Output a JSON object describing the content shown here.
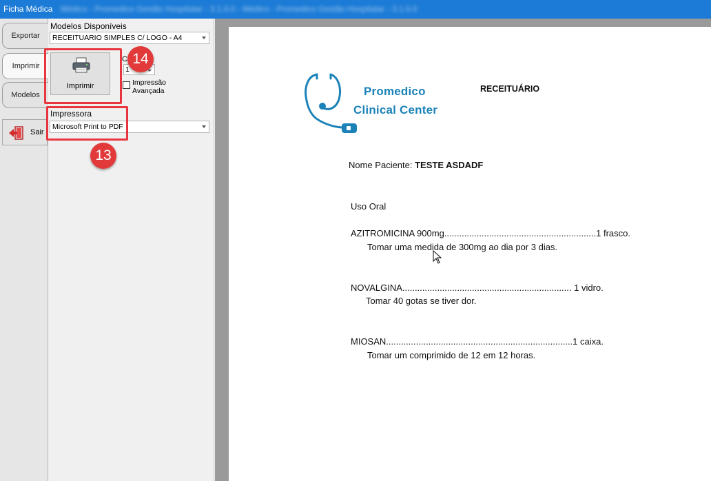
{
  "window": {
    "title": "Ficha Médica",
    "blurred_title": "Médico - Promedico Gestão Hospitalar - 3.1.0.0 - Médico - Promedico Gestão Hospitalar - 3.1.0.0"
  },
  "tabs": {
    "exportar": "Exportar",
    "imprimir": "Imprimir",
    "modelos": "Modelos",
    "sair": "Sair"
  },
  "options": {
    "modelos_label": "Modelos Disponíveis",
    "modelos_value": "RECEITUARIO SIMPLES C/ LOGO - A4",
    "print_button": "Imprimir",
    "copies_label": "C",
    "copies_value": "1",
    "advanced_line1": "Impressão",
    "advanced_line2": "Avançada",
    "printer_label": "Impressora",
    "printer_value": "Microsoft Print to PDF"
  },
  "annotations": {
    "badge_print": "14",
    "badge_printer": "13",
    "color": "#e8353e"
  },
  "document": {
    "logo_line1": "Promedico",
    "logo_line2": "Clinical Center",
    "heading": "RECEITUÁRIO",
    "patient_label": "Nome Paciente: ",
    "patient_name": "TESTE ASDADF",
    "route": "Uso Oral",
    "items": [
      {
        "line": "AZITROMICINA 900mg.............................................................1 frasco.",
        "instruction": "Tomar uma medida de 300mg ao dia por 3 dias."
      },
      {
        "line": "NOVALGINA.................................................................... 1 vidro.",
        "instruction": "Tomar 40 gotas se tiver dor."
      },
      {
        "line": "MIOSAN...........................................................................1 caixa.",
        "instruction": "Tomar um comprimido de 12 em 12 horas."
      }
    ]
  },
  "colors": {
    "titlebar": "#1c7bd6",
    "logo": "#1b82b8"
  }
}
